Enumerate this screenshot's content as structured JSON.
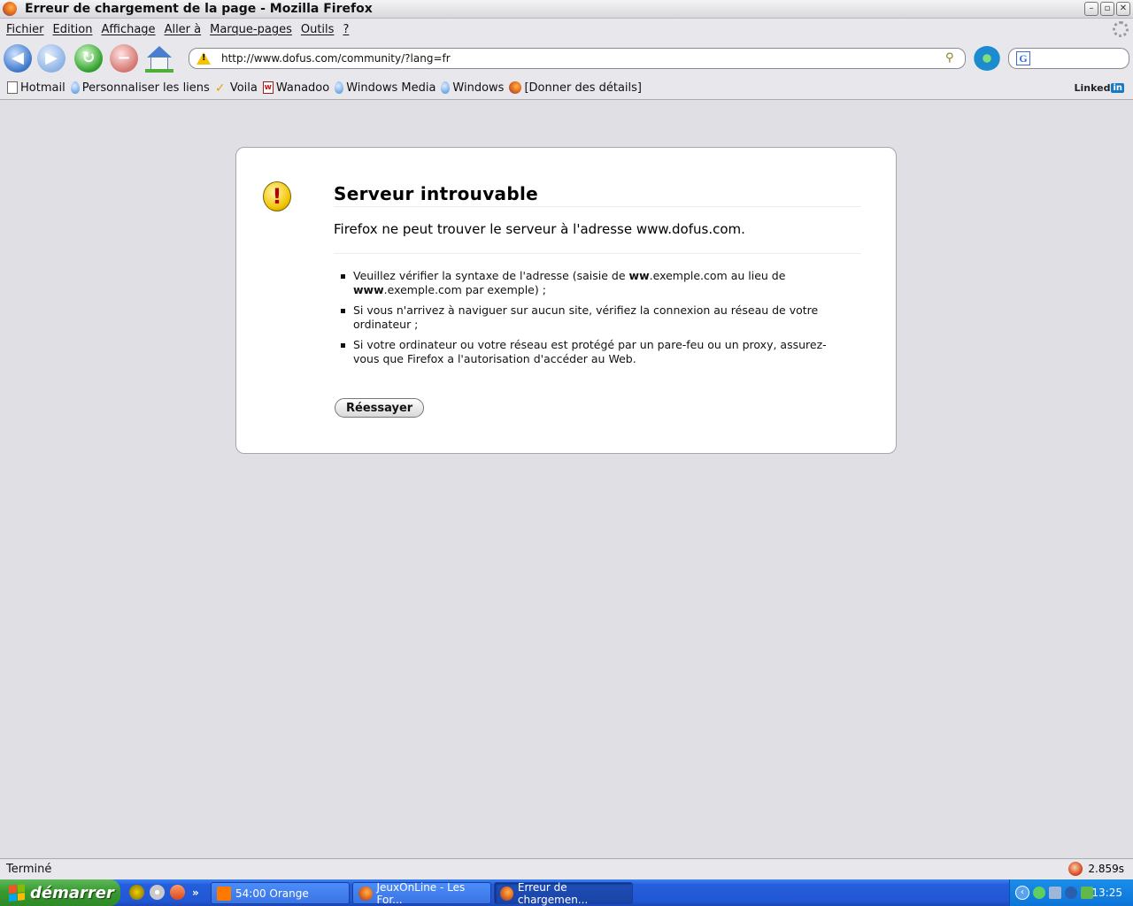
{
  "window": {
    "title": "Erreur de chargement de la page - Mozilla Firefox",
    "min_glyph": "–",
    "max_glyph": "▫",
    "close_glyph": "✕"
  },
  "menu": [
    "Fichier",
    "Edition",
    "Affichage",
    "Aller à",
    "Marque-pages",
    "Outils",
    "?"
  ],
  "address_bar": {
    "url": "http://www.dofus.com/community/?lang=fr"
  },
  "search_bar": {
    "engine_glyph": "G",
    "value": ""
  },
  "bookmarks": [
    {
      "label": "Hotmail",
      "icon": "page-icon"
    },
    {
      "label": "Personnaliser les liens",
      "icon": "pin-icon"
    },
    {
      "label": "Voila",
      "icon": "voila-icon"
    },
    {
      "label": "Wanadoo",
      "icon": "wanadoo-icon"
    },
    {
      "label": "Windows Media",
      "icon": "pin-icon"
    },
    {
      "label": "Windows",
      "icon": "pin-icon"
    },
    {
      "label": "[Donner des détails]",
      "icon": "firefox-icon"
    }
  ],
  "linkedin": {
    "text": "Linked",
    "badge": "in"
  },
  "error": {
    "title": "Serveur introuvable",
    "short_desc": "Firefox ne peut trouver le serveur à l'adresse www.dofus.com.",
    "items": [
      {
        "pre": "Veuillez vérifier la syntaxe de l'adresse (saisie de ",
        "b1": "ww",
        "mid": ".exemple.com au lieu de ",
        "b2": "www",
        "post": ".exemple.com par exemple) ;"
      },
      {
        "text": "Si vous n'arrivez à naviguer sur aucun site, vérifiez la connexion au réseau de votre ordinateur ;"
      },
      {
        "text": "Si votre ordinateur ou votre réseau est protégé par un pare-feu ou un proxy, assurez-vous que Firefox a l'autorisation d'accéder au Web."
      }
    ],
    "retry_label": "Réessayer"
  },
  "status": {
    "text": "Terminé",
    "time": "2.859s"
  },
  "taskbar": {
    "start_label": "démarrer",
    "more": "»",
    "tasks": [
      {
        "label": "54:00 Orange",
        "active": false
      },
      {
        "label": "JeuxOnLine - Les For...",
        "active": false
      },
      {
        "label": "Erreur de chargemen...",
        "active": true
      }
    ],
    "clock": "13:25"
  },
  "colors": {
    "accent": "#245edb",
    "start": "#379a2f",
    "content_bg": "#e0dfe3"
  }
}
